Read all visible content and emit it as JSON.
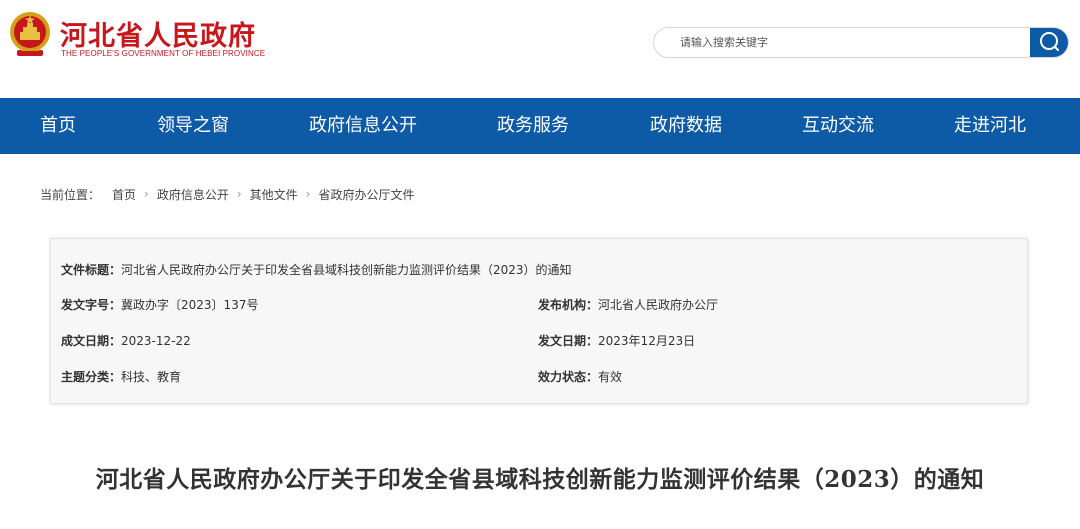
{
  "header": {
    "site_title": "河北省人民政府",
    "site_subtitle": "THE PEOPLE'S GOVERNMENT OF HEBEI PROVINCE",
    "search_placeholder": "请输入搜索关键字"
  },
  "nav": {
    "items": [
      "首页",
      "领导之窗",
      "政府信息公开",
      "政务服务",
      "政府数据",
      "互动交流",
      "走进河北"
    ]
  },
  "breadcrumb": {
    "prefix": "当前位置：",
    "items": [
      "首页",
      "政府信息公开",
      "其他文件",
      "省政府办公厅文件"
    ],
    "separator": "›"
  },
  "document_info": {
    "title_label": "文件标题：",
    "title_value": "河北省人民政府办公厅关于印发全省县域科技创新能力监测评价结果（2023）的通知",
    "number_label": "发文字号：",
    "number_value": "冀政办字〔2023〕137号",
    "issuer_label": "发布机构：",
    "issuer_value": "河北省人民政府办公厅",
    "created_label": "成文日期：",
    "created_value": "2023-12-22",
    "published_label": "发文日期：",
    "published_value": "2023年12月23日",
    "category_label": "主题分类：",
    "category_value": "科技、教育",
    "status_label": "效力状态：",
    "status_value": "有效"
  },
  "document_title": "河北省人民政府办公厅关于印发全省县域科技创新能力监测评价结果（2023）的通知",
  "colors": {
    "brand_red": "#c8161d",
    "nav_blue": "#0d5aa7",
    "info_bg": "#f7f7f7"
  },
  "icons": {
    "emblem": "national-emblem-icon",
    "search": "search-icon"
  }
}
